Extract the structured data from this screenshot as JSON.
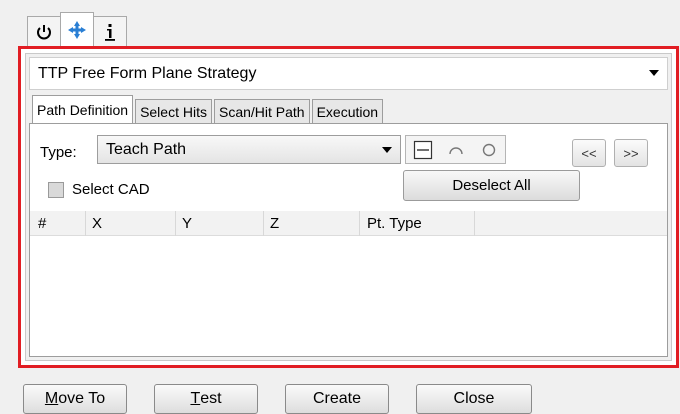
{
  "top_tabs": [
    {
      "icon": "power-icon"
    },
    {
      "icon": "move-icon",
      "active": true
    },
    {
      "icon": "info-icon"
    }
  ],
  "strategy": {
    "selected": "TTP Free Form Plane Strategy"
  },
  "tabs": [
    {
      "label": "Path Definition",
      "active": true
    },
    {
      "label": "Select Hits"
    },
    {
      "label": "Scan/Hit Path"
    },
    {
      "label": "Execution"
    }
  ],
  "path_definition": {
    "type_label": "Type:",
    "type_value": "Teach Path",
    "prev_label": "<<",
    "next_label": ">>",
    "select_cad_label": "Select CAD",
    "deselect_all_label": "Deselect All",
    "columns": [
      "#",
      "X",
      "Y",
      "Z",
      "Pt. Type"
    ]
  },
  "buttons": {
    "move_to_prefix": "M",
    "move_to_rest": "ove To",
    "test_prefix": "T",
    "test_rest": "est",
    "create": "Create",
    "close": "Close"
  },
  "colors": {
    "highlight": "#e11d23",
    "move_icon": "#2a7fd4"
  }
}
